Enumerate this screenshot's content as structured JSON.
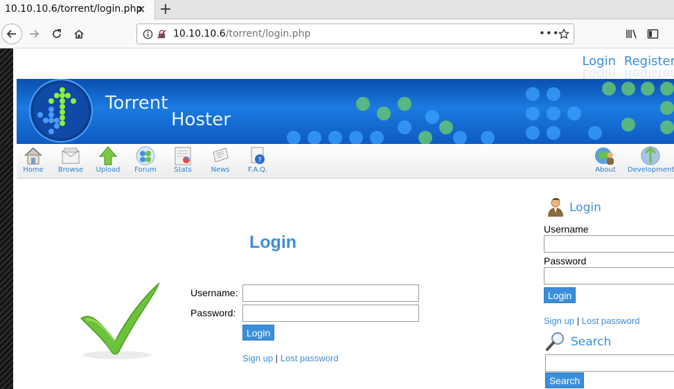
{
  "browser": {
    "tab_title": "10.10.10.6/torrent/login.php",
    "url_host": "10.10.10.6",
    "url_path": "/torrent/login.php",
    "icons": [
      "back-icon",
      "forward-icon",
      "reload-icon",
      "home-icon",
      "info-icon",
      "insecure-lock-icon",
      "page-actions-icon",
      "bookmark-star-icon",
      "library-icon",
      "sidebar-icon"
    ]
  },
  "top_links": {
    "login": "Login",
    "register": "Register"
  },
  "banner": {
    "title_line1": "Torrent",
    "title_line2": "Hoster"
  },
  "toolbar": {
    "items": [
      {
        "label": "Home",
        "icon": "house-icon"
      },
      {
        "label": "Browse",
        "icon": "browse-icon"
      },
      {
        "label": "Upload",
        "icon": "upload-arrow-icon"
      },
      {
        "label": "Forum",
        "icon": "forum-people-icon"
      },
      {
        "label": "Stats",
        "icon": "stats-chart-icon"
      },
      {
        "label": "News",
        "icon": "news-icon"
      },
      {
        "label": "F.A.Q.",
        "icon": "faq-icon"
      }
    ],
    "right_items": [
      {
        "label": "About",
        "icon": "about-icon"
      },
      {
        "label": "Development",
        "icon": "development-icon"
      }
    ]
  },
  "main": {
    "title": "Login",
    "username_label": "Username:",
    "password_label": "Password:",
    "login_button": "Login",
    "signup_link": "Sign up",
    "separator": "|",
    "lost_password_link": "Lost password"
  },
  "sidebar": {
    "login_title": "Login",
    "username_label": "Username",
    "password_label": "Password",
    "login_button": "Login",
    "signup_link": "Sign up",
    "separator": "|",
    "lost_password_link": "Lost password",
    "search_title": "Search",
    "search_button": "Search"
  },
  "colors": {
    "accent": "#3b8ed9",
    "banner": "#1b7be0"
  }
}
